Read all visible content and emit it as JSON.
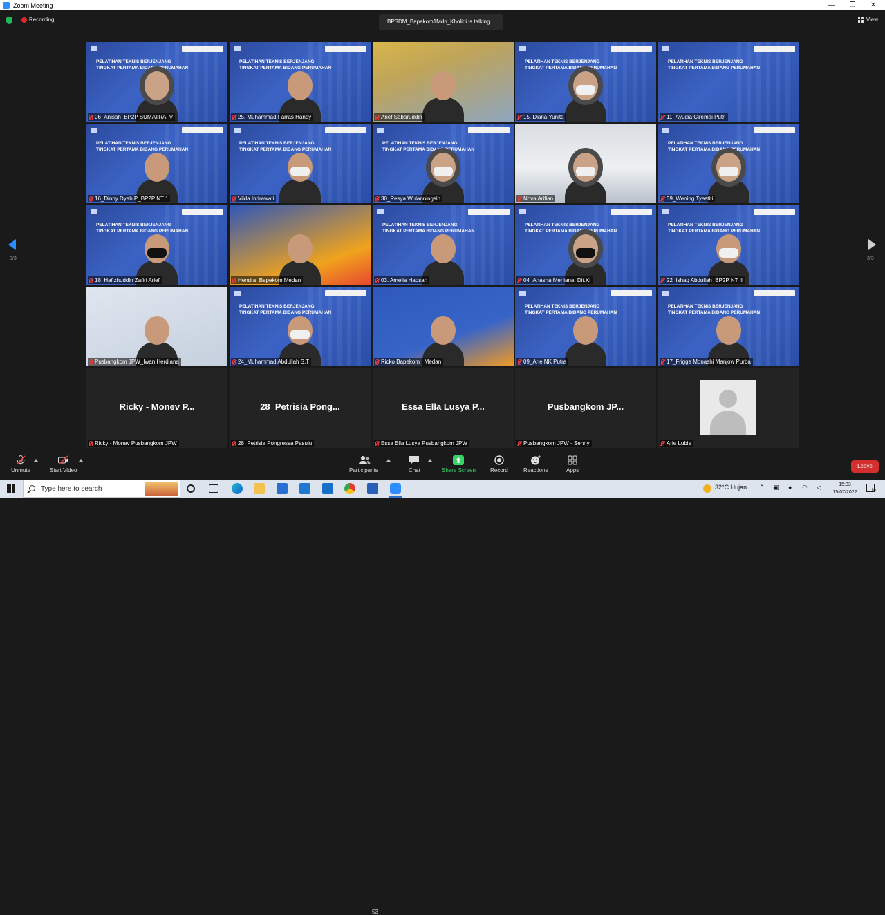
{
  "window": {
    "title": "Zoom Meeting",
    "minimize": "—",
    "restore": "❐",
    "close": "✕"
  },
  "topbar": {
    "recording_label": "Recording",
    "talking_label": "BPSDM_Bapekom1Mdn_Kholidi is talking...",
    "view_label": "View"
  },
  "pager": {
    "left": "3/3",
    "right": "3/3"
  },
  "background_title_line1": "PELATIHAN TEKNIS BERJENJANG",
  "background_title_line2": "TINGKAT PERTAMA BIDANG PERUMAHAN",
  "tiles": [
    {
      "name": "06_Anisah_BP2P SUMATRA_V",
      "style": "video",
      "person": "hijab"
    },
    {
      "name": "25. Muhammad Farras Handy",
      "style": "video",
      "person": "plain"
    },
    {
      "name": "Arief Sabaruddin",
      "style": "photo1",
      "person": "plain"
    },
    {
      "name": "15. Diana Yunita",
      "style": "video",
      "person": "hijab-mask"
    },
    {
      "name": "11_Ayudia Ciremai Putri",
      "style": "video",
      "person": "none"
    },
    {
      "name": "16_Dinny Dyah P_BP2P NT 1",
      "style": "video",
      "person": "plain"
    },
    {
      "name": "Vilda Indrawati",
      "style": "video",
      "person": "mask"
    },
    {
      "name": "30_Resya Wulanningsih",
      "style": "video",
      "person": "hijab-mask"
    },
    {
      "name": "Nova Arifian",
      "style": "photo2",
      "person": "hijab-mask"
    },
    {
      "name": "39_Wening Tyastiti",
      "style": "video",
      "person": "hijab-mask"
    },
    {
      "name": "18_Hafizhuddin Zafiri Arief",
      "style": "video",
      "person": "mask-black"
    },
    {
      "name": "Hendra_Bapekom Medan",
      "style": "photo3",
      "person": "plain"
    },
    {
      "name": "03. Amelia Hapsari",
      "style": "video",
      "person": "plain"
    },
    {
      "name": "04_Anasha Merliana_Dit.KI",
      "style": "video",
      "person": "hijab-mask-black"
    },
    {
      "name": "22_Ishaq Abdullah_BP2P NT II",
      "style": "video",
      "person": "mask"
    },
    {
      "name": "Pusbangkom JPW_Iwan Herdiana",
      "style": "photo4",
      "person": "plain"
    },
    {
      "name": "24_Muhammad Abdullah S.T",
      "style": "video",
      "person": "mask"
    },
    {
      "name": "Ricko Bapekom I Medan",
      "style": "photo5",
      "person": "plain"
    },
    {
      "name": "09_Arie NK Putra",
      "style": "video",
      "person": "plain"
    },
    {
      "name": "17_Frigga Monashi Manjow Purba",
      "style": "video",
      "person": "plain"
    },
    {
      "name": "Ricky - Monev Pusbangkom JPW",
      "style": "dark",
      "display": "Ricky - Monev P..."
    },
    {
      "name": "28_Petrisia Pongressa Pasulu",
      "style": "dark",
      "display": "28_Petrisia Pong..."
    },
    {
      "name": "Essa Ella Lusya Pusbangkom JPW",
      "style": "dark",
      "display": "Essa Ella Lusya P..."
    },
    {
      "name": "Pusbangkom JPW - Senny",
      "style": "dark",
      "display": "Pusbangkom JP..."
    },
    {
      "name": "Arie Lubis",
      "style": "avatar"
    }
  ],
  "toolbar": {
    "unmute": "Unmute",
    "start_video": "Start Video",
    "participants": "Participants",
    "participants_count": "53",
    "chat": "Chat",
    "share_screen": "Share Screen",
    "record": "Record",
    "reactions": "Reactions",
    "apps": "Apps",
    "leave": "Leave"
  },
  "taskbar": {
    "search_placeholder": "Type here to search",
    "weather": "32°C  Hujan",
    "time": "15:33",
    "date": "15/07/2022",
    "notification_count": "10"
  },
  "colors": {
    "accent": "#2d8cff",
    "leave": "#d32f2f",
    "share_green": "#39d36a",
    "mute_red": "#e23b3b"
  }
}
